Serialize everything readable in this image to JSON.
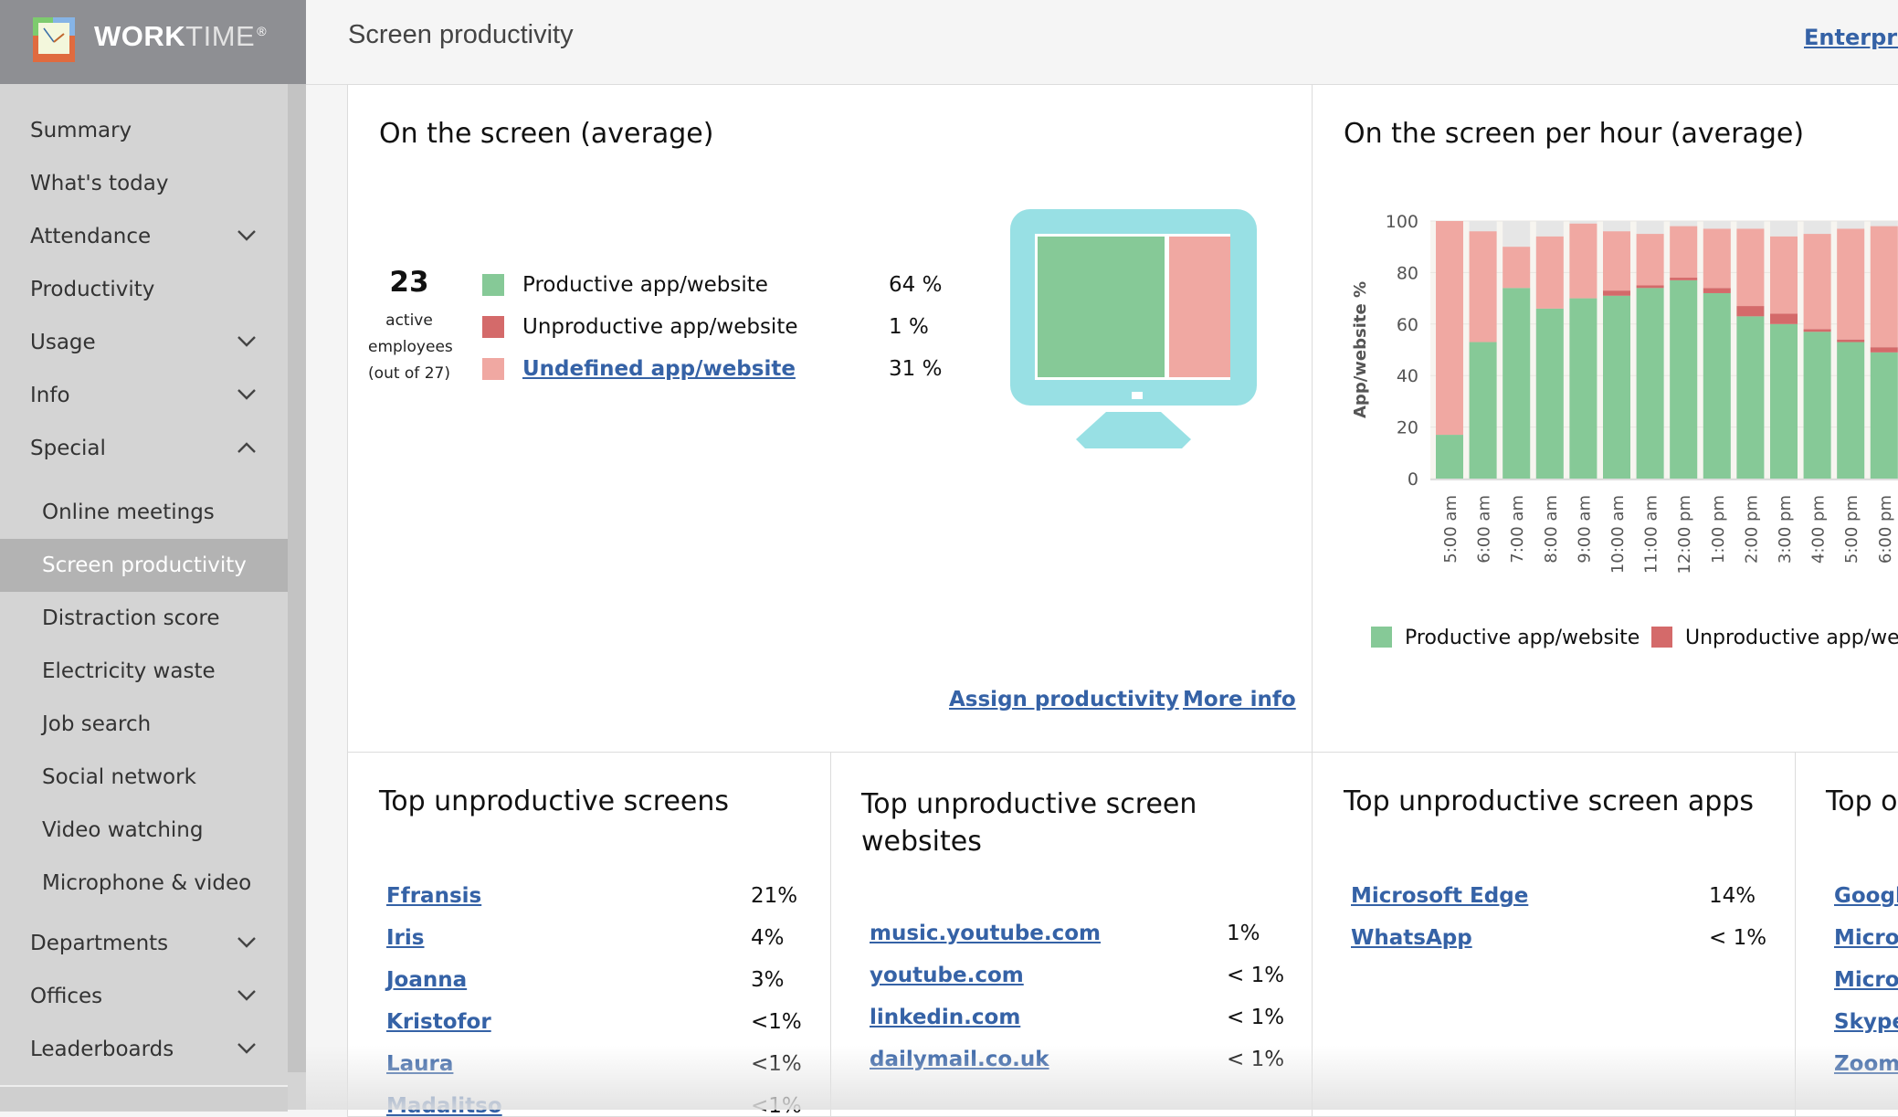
{
  "app": {
    "brand_bold": "WORK",
    "brand_light": "TIME",
    "brand_mark": "®"
  },
  "header": {
    "title": "Screen productivity",
    "plan_link": "Enterprise"
  },
  "sidebar": {
    "items": [
      {
        "label": "Summary",
        "chevron": "none"
      },
      {
        "label": "What's today",
        "chevron": "none"
      },
      {
        "label": "Attendance",
        "chevron": "down"
      },
      {
        "label": "Productivity",
        "chevron": "none"
      },
      {
        "label": "Usage",
        "chevron": "down"
      },
      {
        "label": "Info",
        "chevron": "down"
      },
      {
        "label": "Special",
        "chevron": "up"
      }
    ],
    "special_subitems": [
      {
        "label": "Online meetings",
        "active": false
      },
      {
        "label": "Screen productivity",
        "active": true
      },
      {
        "label": "Distraction score",
        "active": false
      },
      {
        "label": "Electricity waste",
        "active": false
      },
      {
        "label": "Job search",
        "active": false
      },
      {
        "label": "Social network",
        "active": false
      },
      {
        "label": "Video watching",
        "active": false
      },
      {
        "label": "Microphone & video",
        "active": false
      }
    ],
    "bottom_items": [
      {
        "label": "Departments",
        "chevron": "down"
      },
      {
        "label": "Offices",
        "chevron": "down"
      },
      {
        "label": "Leaderboards",
        "chevron": "down"
      }
    ]
  },
  "on_screen": {
    "title": "On the screen (average)",
    "active_count": "23",
    "active_label_1": "active",
    "active_label_2": "employees",
    "active_label_3": "(out of 27)",
    "legend": [
      {
        "label": "Productive app/website",
        "value": "64 %",
        "color": "#86c997",
        "is_link": false
      },
      {
        "label": "Unproductive app/website",
        "value": "1 %",
        "color": "#d46a6a",
        "is_link": false
      },
      {
        "label": "Undefined app/website",
        "value": "31 %",
        "color": "#f0a8a2",
        "is_link": true
      }
    ],
    "monitor_shares": {
      "productive": 64,
      "unproductive": 1,
      "undefined": 31
    },
    "assign_link": "Assign productivity",
    "more_info_link": "More info"
  },
  "chart_data": {
    "type": "bar",
    "stacked": true,
    "title": "On the screen per hour (average)",
    "xlabel": "",
    "ylabel": "App/website %",
    "ylim": [
      0,
      100
    ],
    "yticks": [
      0,
      20,
      40,
      60,
      80,
      100
    ],
    "grid": true,
    "categories": [
      "5:00 am",
      "6:00 am",
      "7:00 am",
      "8:00 am",
      "9:00 am",
      "10:00 am",
      "11:00 am",
      "12:00 pm",
      "1:00 pm",
      "2:00 pm",
      "3:00 pm",
      "4:00 pm",
      "5:00 pm",
      "6:00 pm"
    ],
    "series": [
      {
        "name": "Productive app/website",
        "color": "#86c997",
        "values": [
          17,
          53,
          74,
          66,
          70,
          71,
          74,
          77,
          72,
          63,
          60,
          57,
          53,
          49
        ]
      },
      {
        "name": "Unproductive app/website",
        "color": "#d46a6a",
        "values": [
          0,
          0,
          0,
          0,
          0,
          2,
          1,
          1,
          2,
          4,
          4,
          1,
          1,
          2
        ]
      },
      {
        "name": "Undefined app/website",
        "color": "#f0a8a2",
        "values": [
          83,
          43,
          16,
          28,
          29,
          23,
          20,
          20,
          23,
          30,
          30,
          37,
          43,
          47
        ]
      }
    ],
    "remainder_color": "#e6e6e6",
    "legend_position": "bottom",
    "legend_visible": [
      "Productive app/website",
      "Unproductive app/webl"
    ]
  },
  "top_screens": {
    "title": "Top unproductive screens",
    "rows": [
      {
        "name": "Ffransis",
        "value": "21%"
      },
      {
        "name": "Iris",
        "value": "4%"
      },
      {
        "name": "Joanna",
        "value": "3%"
      },
      {
        "name": "Kristofor",
        "value": "<1%"
      },
      {
        "name": "Laura",
        "value": "<1%"
      },
      {
        "name": "Madalitso",
        "value": "<1%"
      }
    ]
  },
  "top_websites": {
    "title_line1": "Top unproductive screen",
    "title_line2": "websites",
    "rows": [
      {
        "name": "music.youtube.com",
        "value": "1%"
      },
      {
        "name": "youtube.com",
        "value": "< 1%"
      },
      {
        "name": "linkedin.com",
        "value": "< 1%"
      },
      {
        "name": "dailymail.co.uk",
        "value": "< 1%"
      }
    ]
  },
  "top_apps": {
    "title": "Top unproductive screen apps",
    "rows": [
      {
        "name": "Microsoft Edge",
        "value": "14%"
      },
      {
        "name": "WhatsApp",
        "value": "< 1%"
      }
    ]
  },
  "top_other": {
    "title": "Top o",
    "rows": [
      {
        "name": "Googl"
      },
      {
        "name": "Micros"
      },
      {
        "name": "Micros"
      },
      {
        "name": "Skype"
      },
      {
        "name": "Zoom"
      }
    ]
  }
}
